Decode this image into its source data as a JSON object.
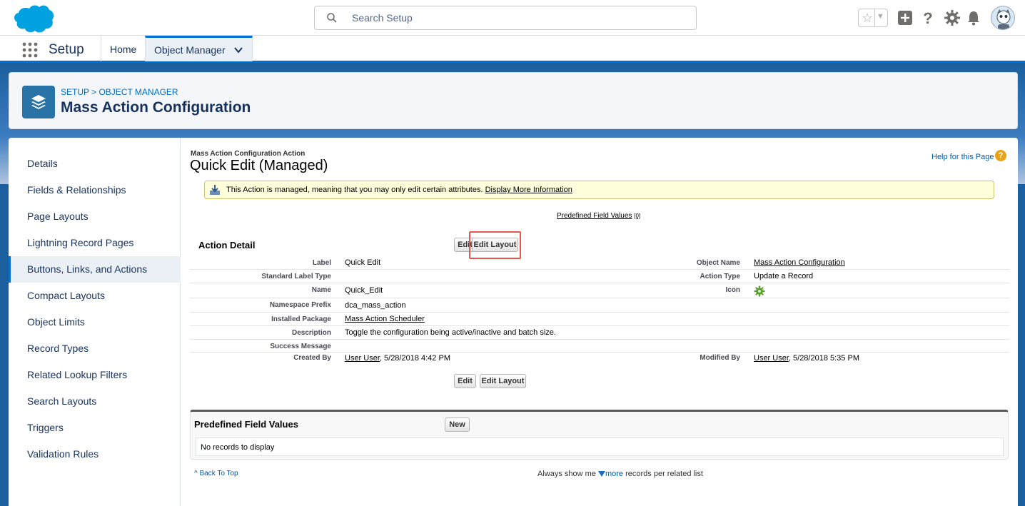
{
  "header": {
    "search_placeholder": "Search Setup"
  },
  "app_nav": {
    "app_name": "Setup",
    "tabs": [
      {
        "label": "Home"
      },
      {
        "label": "Object Manager"
      }
    ]
  },
  "page_header": {
    "breadcrumb": "SETUP > OBJECT MANAGER",
    "title": "Mass Action Configuration"
  },
  "sidebar": {
    "items": [
      {
        "label": "Details"
      },
      {
        "label": "Fields & Relationships"
      },
      {
        "label": "Page Layouts"
      },
      {
        "label": "Lightning Record Pages"
      },
      {
        "label": "Buttons, Links, and Actions",
        "active": true
      },
      {
        "label": "Compact Layouts"
      },
      {
        "label": "Object Limits"
      },
      {
        "label": "Record Types"
      },
      {
        "label": "Related Lookup Filters"
      },
      {
        "label": "Search Layouts"
      },
      {
        "label": "Triggers"
      },
      {
        "label": "Validation Rules"
      }
    ]
  },
  "main": {
    "record_type": "Mass Action Configuration Action",
    "title": "Quick Edit (Managed)",
    "help_link": "Help for this Page",
    "help_icon_glyph": "?",
    "banner": {
      "message": "This Action is managed, meaning that you may only edit certain attributes.",
      "link": "Display More Information"
    },
    "predefined_link": {
      "label": "Predefined Field Values",
      "count": "[0]"
    },
    "section_title": "Action Detail",
    "buttons": {
      "edit": "Edit",
      "edit_layout": "Edit Layout",
      "new": "New"
    },
    "fields": {
      "label_lbl": "Label",
      "label_val": "Quick Edit",
      "std_label_lbl": "Standard Label Type",
      "std_label_val": "",
      "name_lbl": "Name",
      "name_val": "Quick_Edit",
      "ns_lbl": "Namespace Prefix",
      "ns_val": "dca_mass_action",
      "pkg_lbl": "Installed Package",
      "pkg_val": "Mass Action Scheduler",
      "desc_lbl": "Description",
      "desc_val": "Toggle the configuration being active/inactive and batch size.",
      "success_lbl": "Success Message",
      "success_val": "",
      "created_lbl": "Created By",
      "created_user": "User User",
      "created_date": ", 5/28/2018 4:42 PM",
      "obj_lbl": "Object Name",
      "obj_val": "Mass Action Configuration",
      "type_lbl": "Action Type",
      "type_val": "Update a Record",
      "icon_lbl": "Icon",
      "modified_lbl": "Modified By",
      "modified_user": "User User",
      "modified_date": ", 5/28/2018 5:35 PM"
    },
    "related_list": {
      "title": "Predefined Field Values",
      "empty": "No records to display"
    },
    "footer": {
      "back_to_top": "Back To Top",
      "always_prefix": "Always show me",
      "more": "more",
      "always_suffix": "records per related list"
    }
  },
  "colors": {
    "brand_blue": "#0070d2",
    "link_blue": "#015ba7",
    "highlight_red": "#e05a52",
    "banner_yellow": "#ffffdc"
  }
}
